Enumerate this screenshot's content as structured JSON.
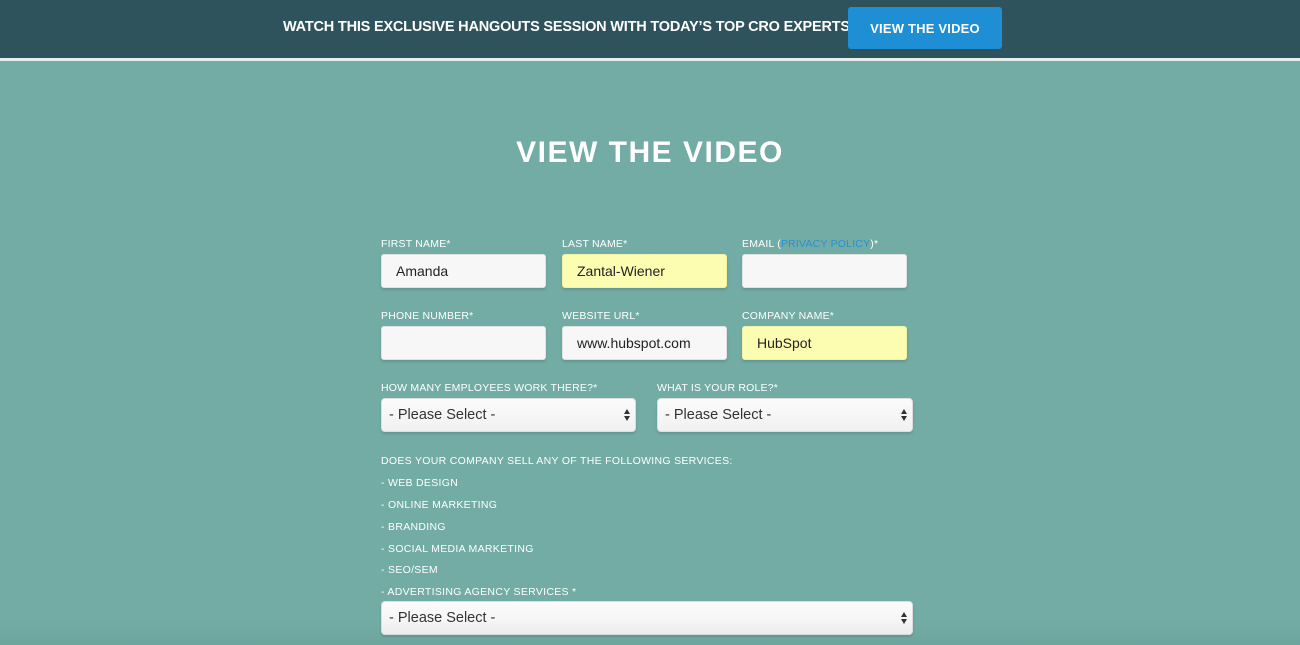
{
  "banner": {
    "text": "WATCH THIS EXCLUSIVE HANGOUTS SESSION WITH TODAY’S TOP CRO EXPERTS.",
    "button_label": "VIEW THE VIDEO"
  },
  "form": {
    "heading": "VIEW THE VIDEO",
    "fields": {
      "first_name": {
        "label": "FIRST NAME*",
        "value": "Amanda"
      },
      "last_name": {
        "label": "LAST NAME*",
        "value": "Zantal-Wiener"
      },
      "email": {
        "label_prefix": "EMAIL (",
        "label_link": "PRIVACY POLICY",
        "label_suffix": ")*",
        "value": ""
      },
      "phone": {
        "label": "PHONE NUMBER*",
        "value": ""
      },
      "website": {
        "label": "WEBSITE URL*",
        "value": "www.hubspot.com"
      },
      "company": {
        "label": "COMPANY NAME*",
        "value": "HubSpot"
      },
      "employees": {
        "label": "HOW MANY EMPLOYEES WORK THERE?*",
        "selected": "- Please Select -"
      },
      "role": {
        "label": "WHAT IS YOUR ROLE?*",
        "selected": "- Please Select -"
      },
      "services": {
        "question": "DOES YOUR COMPANY SELL ANY OF THE FOLLOWING SERVICES:",
        "items": [
          "- WEB DESIGN",
          "- ONLINE MARKETING",
          "- BRANDING",
          "- SOCIAL MEDIA MARKETING",
          "- SEO/SEM",
          "- ADVERTISING AGENCY SERVICES *"
        ],
        "selected": "- Please Select -"
      }
    }
  },
  "colors": {
    "banner_bg": "#2f535c",
    "page_bg": "#72aca4",
    "button_bg": "#1e8fd5",
    "autofill_bg": "#fdfdb2",
    "link": "#2a8fd6"
  }
}
